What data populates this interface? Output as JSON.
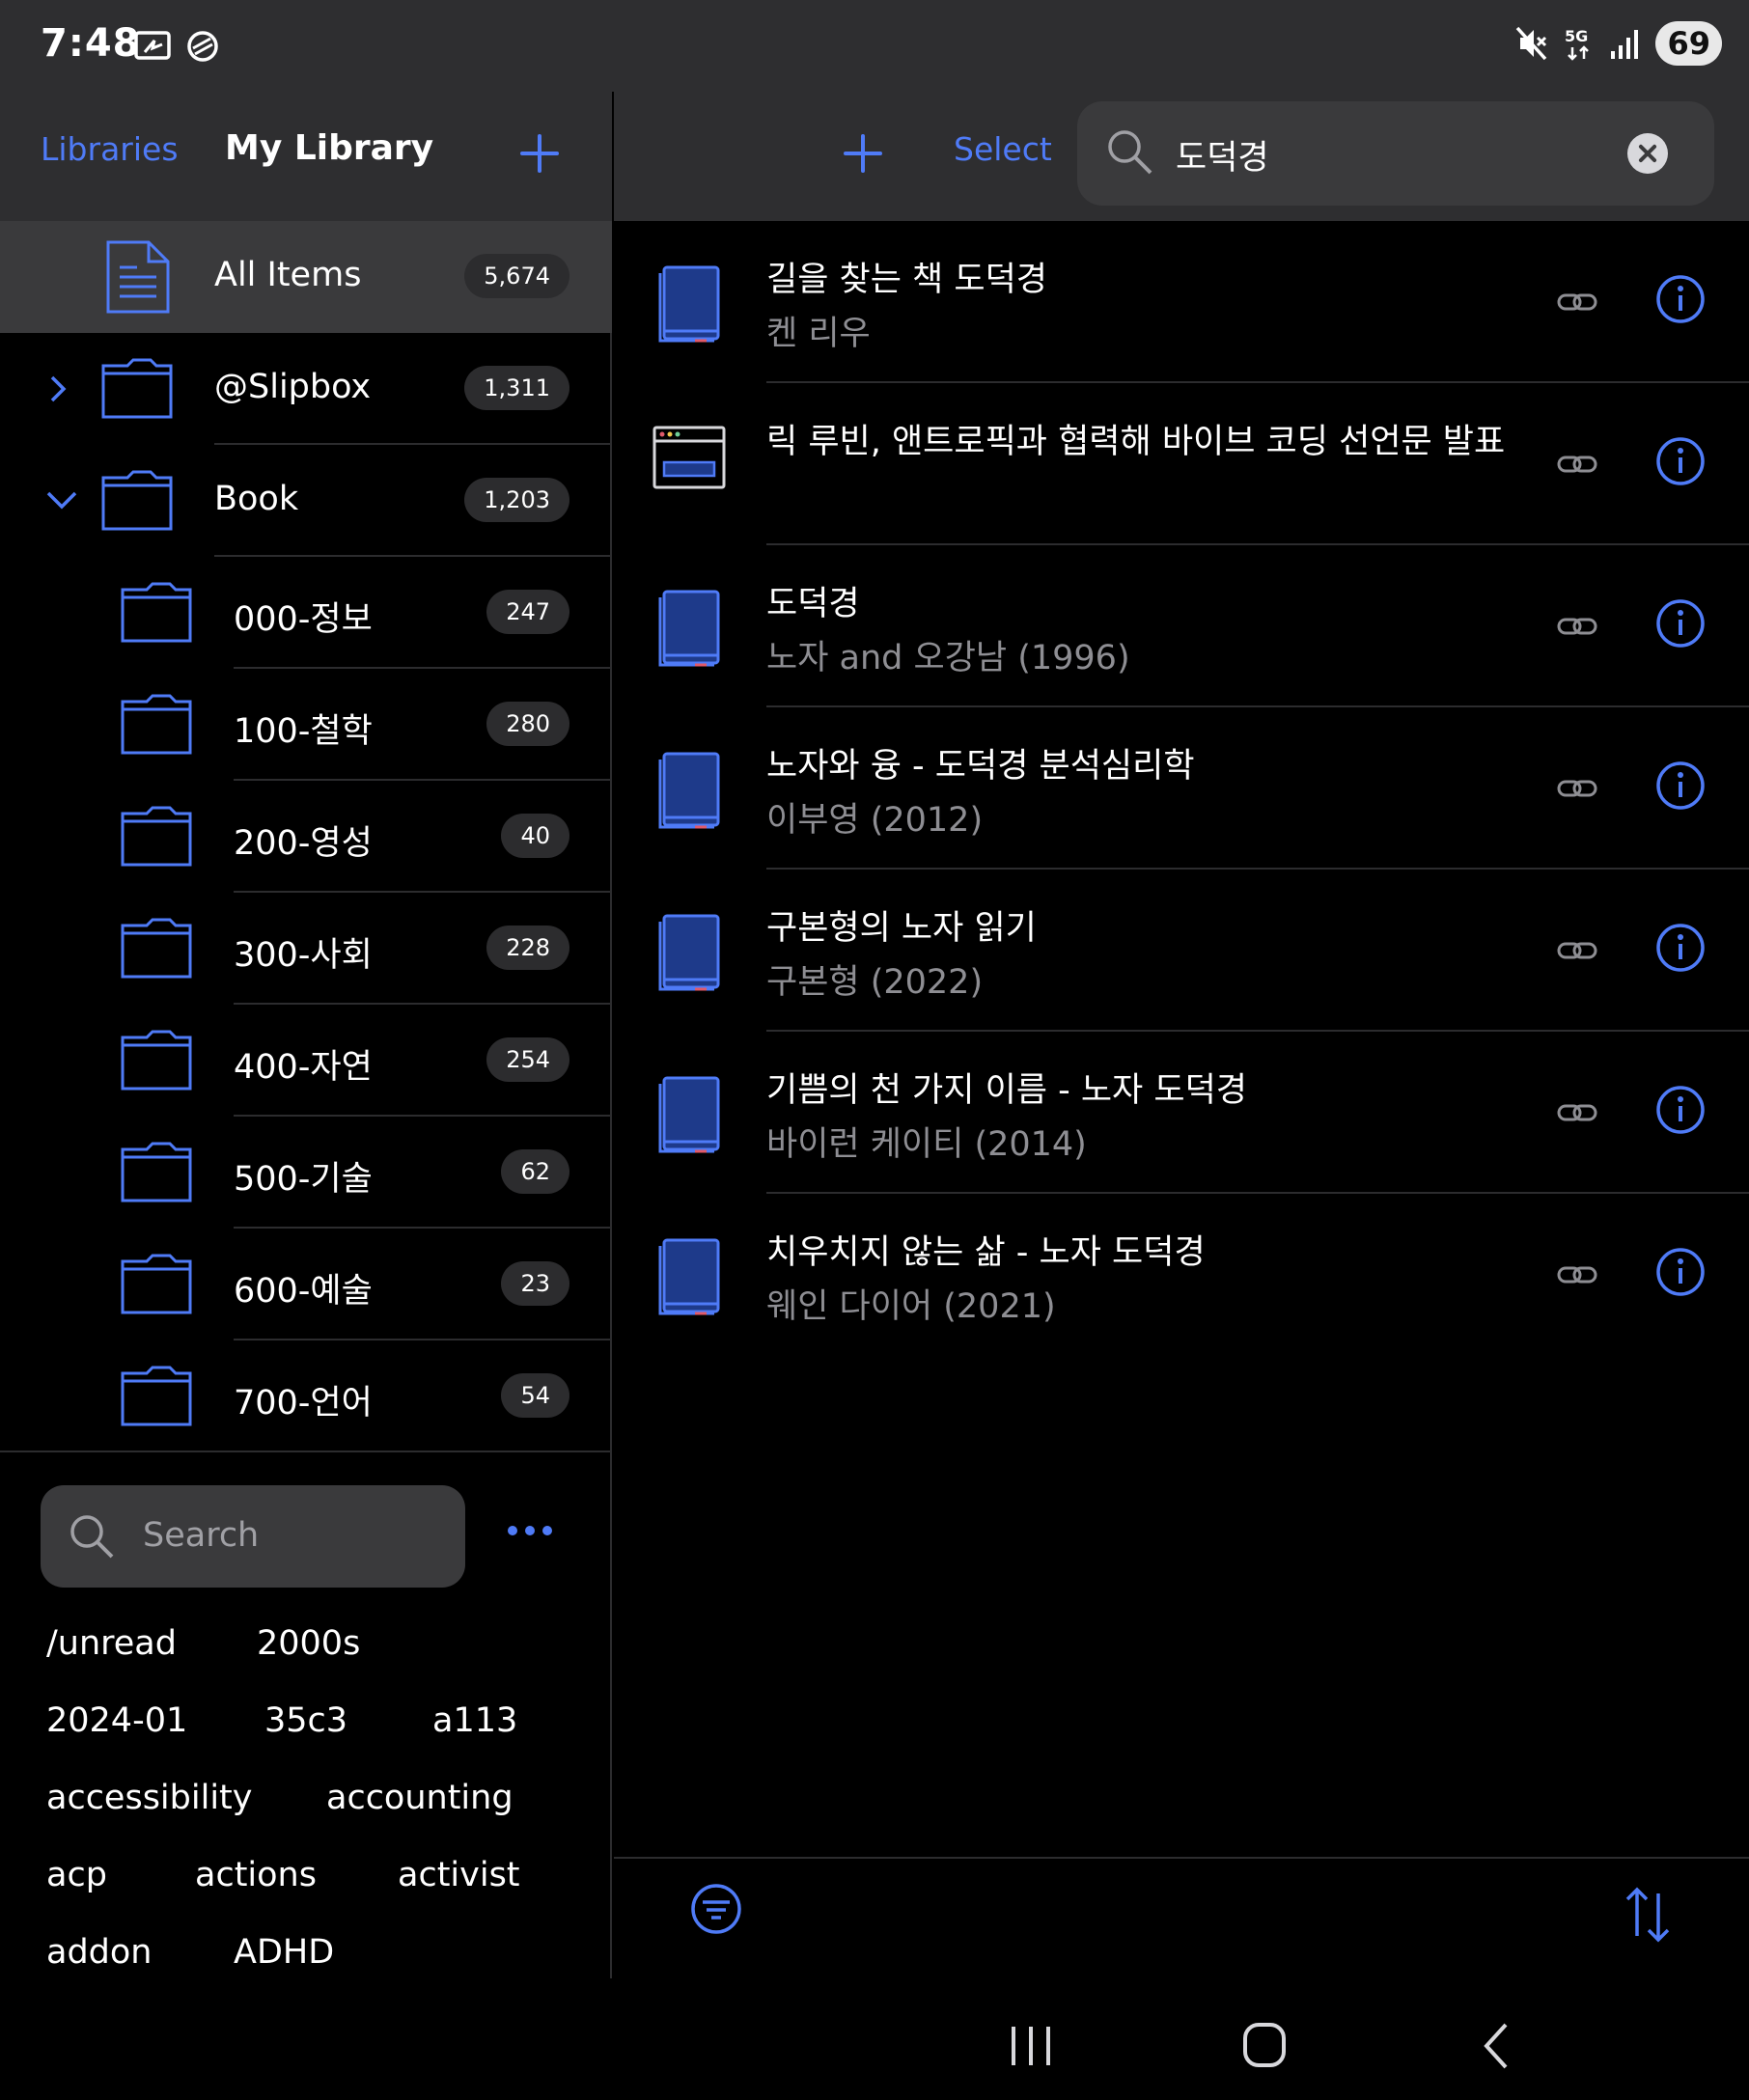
{
  "status_bar": {
    "time": "7:48",
    "left_icons": [
      "screen-record-icon",
      "sync-icon"
    ],
    "right_icons": [
      "mute-icon",
      "5g-icon",
      "signal-icon"
    ],
    "battery": "69"
  },
  "sidebar": {
    "header": {
      "back_label": "Libraries",
      "title": "My Library",
      "add_icon": "plus-icon"
    },
    "tree": [
      {
        "label": "All Items",
        "count": "5,674",
        "icon": "document-icon",
        "selected": true
      },
      {
        "label": "@Slipbox",
        "count": "1,311",
        "icon": "folder-icon",
        "expander": "chevron-right-icon"
      },
      {
        "label": "Book",
        "count": "1,203",
        "icon": "folder-icon",
        "expander": "chevron-down-icon"
      },
      {
        "label": "000-정보",
        "count": "247",
        "icon": "folder-icon"
      },
      {
        "label": "100-철학",
        "count": "280",
        "icon": "folder-icon"
      },
      {
        "label": "200-영성",
        "count": "40",
        "icon": "folder-icon"
      },
      {
        "label": "300-사회",
        "count": "228",
        "icon": "folder-icon"
      },
      {
        "label": "400-자연",
        "count": "254",
        "icon": "folder-icon"
      },
      {
        "label": "500-기술",
        "count": "62",
        "icon": "folder-icon"
      },
      {
        "label": "600-예술",
        "count": "23",
        "icon": "folder-icon"
      },
      {
        "label": "700-언어",
        "count": "54",
        "icon": "folder-icon"
      }
    ],
    "search": {
      "placeholder": "Search"
    },
    "more_icon": "more-horizontal-icon",
    "tags": [
      "/unread",
      "2000s",
      "2024-01",
      "35c3",
      "a113",
      "accessibility",
      "accounting",
      "acp",
      "actions",
      "activist",
      "addon",
      "ADHD"
    ]
  },
  "main": {
    "toolbar": {
      "add_icon": "plus-icon",
      "select_label": "Select",
      "search_value": "도덕경"
    },
    "items": [
      {
        "title": "길을 찾는 책 도덕경",
        "subtitle": "켄 리우",
        "type": "book"
      },
      {
        "title": "릭 루빈, 앤트로픽과 협력해 바이브 코딩 선언문 발표",
        "subtitle": "",
        "type": "webpage"
      },
      {
        "title": "도덕경",
        "subtitle": "노자 and 오강남 (1996)",
        "type": "book"
      },
      {
        "title": "노자와 융 - 도덕경 분석심리학",
        "subtitle": "이부영 (2012)",
        "type": "book"
      },
      {
        "title": "구본형의 노자 읽기",
        "subtitle": "구본형 (2022)",
        "type": "book"
      },
      {
        "title": "기쁨의 천 가지 이름 - 노자 도덕경",
        "subtitle": "바이런 케이티 (2014)",
        "type": "book"
      },
      {
        "title": "치우치지 않는 삶 - 노자 도덕경",
        "subtitle": "웨인 다이어 (2021)",
        "type": "book"
      }
    ],
    "bottom_bar": {
      "filter_icon": "filter-icon",
      "sort_icon": "sort-icon"
    }
  },
  "nav_bar": [
    "recents-icon",
    "home-icon",
    "back-icon"
  ],
  "colors": {
    "accent": "#4f7bf7",
    "header_bg": "#2e2e30",
    "background": "#000000",
    "selected_row": "#3a3a3c",
    "secondary_text": "#8e8e93"
  }
}
